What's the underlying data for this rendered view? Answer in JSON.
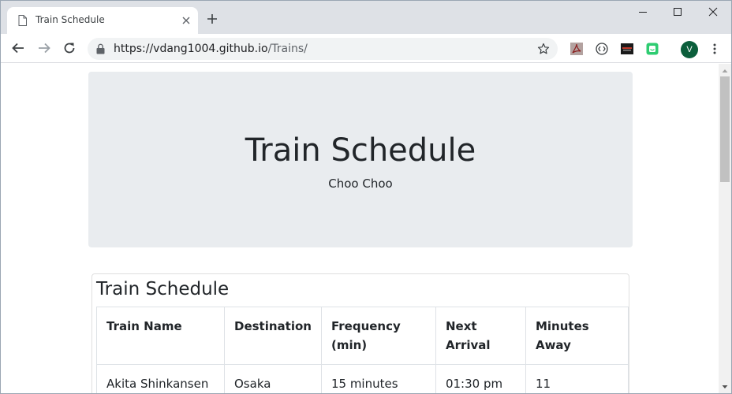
{
  "tab": {
    "title": "Train Schedule"
  },
  "address_bar": {
    "host": "https://vdang1004.github.io",
    "path": "/Trains/"
  },
  "profile": {
    "initial": "V",
    "color": "#0b5e3b"
  },
  "page": {
    "jumbotron": {
      "title": "Train Schedule",
      "subtitle": "Choo Choo"
    },
    "card": {
      "title": "Train Schedule",
      "columns": [
        "Train Name",
        "Destination",
        "Frequency (min)",
        "Next Arrival",
        "Minutes Away"
      ],
      "rows": [
        [
          "Akita Shinkansen",
          "Osaka",
          "15 minutes",
          "01:30 pm",
          "11"
        ]
      ]
    }
  },
  "colors": {
    "jumbotron_bg": "#e9ecef",
    "tabstrip_bg": "#dee1e6",
    "text": "#212529"
  },
  "icons": [
    "page-icon",
    "close-icon",
    "plus-icon",
    "minimize-icon",
    "maximize-icon",
    "window-close-icon",
    "back-icon",
    "forward-icon",
    "reload-icon",
    "lock-icon",
    "star-icon",
    "pdf-extension-icon",
    "code-extension-icon",
    "dark-extension-icon",
    "green-extension-icon",
    "more-menu-icon"
  ]
}
